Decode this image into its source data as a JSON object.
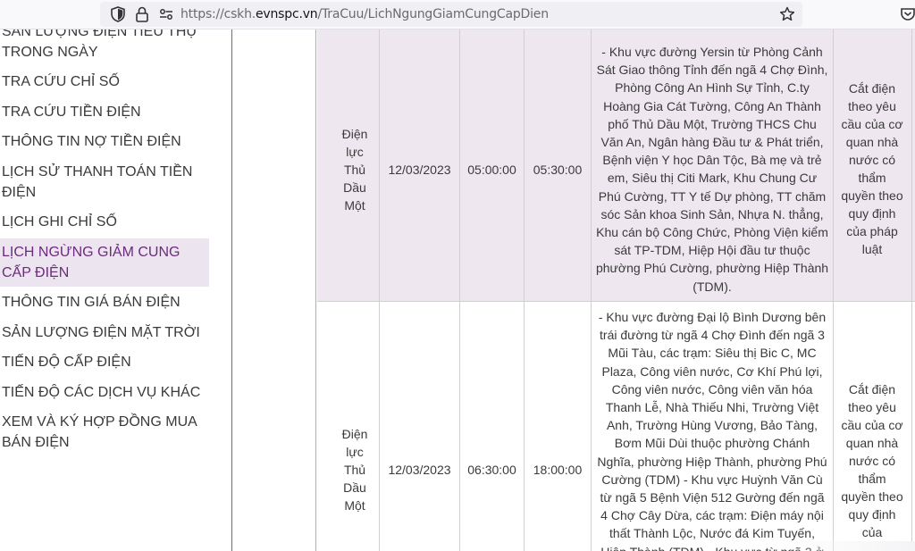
{
  "browser": {
    "url_prefix": "https://cskh.",
    "url_host": "evnspc.vn",
    "url_path": "/TraCuu/LichNgungGiamCungCapDien"
  },
  "sidebar": {
    "items": [
      {
        "label": "SẢN LƯỢNG ĐIỆN TIÊU THỤ TRONG NGÀY"
      },
      {
        "label": "TRA CỨU CHỈ SỐ"
      },
      {
        "label": "TRA CỨU TIỀN ĐIỆN"
      },
      {
        "label": "THÔNG TIN NỢ TIỀN ĐIỆN"
      },
      {
        "label": "LỊCH SỬ THANH TOÁN TIỀN ĐIỆN"
      },
      {
        "label": "LỊCH GHI CHỈ SỐ"
      },
      {
        "label": "LỊCH NGỪNG GIẢM CUNG CẤP ĐIỆN"
      },
      {
        "label": "THÔNG TIN GIÁ BÁN ĐIỆN"
      },
      {
        "label": "SẢN LƯỢNG ĐIỆN MẶT TRỜI"
      },
      {
        "label": "TIẾN ĐỘ CẤP ĐIỆN"
      },
      {
        "label": "TIẾN ĐỘ CÁC DỊCH VỤ KHÁC"
      },
      {
        "label": "XEM VÀ KÝ HỢP ĐỒNG MUA BÁN ĐIỆN"
      }
    ]
  },
  "table": {
    "rows": [
      {
        "unit": "Điện lực Thủ Dầu Một",
        "date": "12/03/2023",
        "start": "05:00:00",
        "end": "05:30:00",
        "area": "- Khu vực đường Yersin từ Phòng Cảnh Sát Giao thông Tỉnh đến ngã 4 Chợ Đình, Phòng Công An Hình Sự Tỉnh, C.ty Hoàng Gia Cát Tường, Công An Thành phố Thủ Dầu Một, Trường THCS Chu Văn An, Ngân hàng Đầu tư & Phát triển, Bệnh viện Y học Dân Tộc, Bà mẹ và trẻ em, Siêu thị Citi Mark, Khu Chung Cư Phú Cường, TT Y tế Dự phòng, TT chăm sóc Sản khoa Sinh Sản, Nhựa N. thẳng, Khu cán bộ Công Chức, Phòng Viện kiểm sát TP-TDM, Hiệp Hội đầu tư thuộc phường Phú Cường, phường Hiệp Thành (TDM).",
        "reason": "Cắt điện theo yêu cầu của cơ quan nhà nước có thẩm quyền theo quy định của pháp luật"
      },
      {
        "unit": "Điện lực Thủ Dầu Một",
        "date": "12/03/2023",
        "start": "06:30:00",
        "end": "18:00:00",
        "area": "- Khu vực đường Đại lộ Bình Dương bên trái đường từ ngã 4 Chợ Đình đến ngã 3 Mũi Tàu, các trạm: Siêu thị Bic C, MC Plaza, Công viên nước, Cơ Khí Phú lợi, Công viên nước, Công viên văn hóa Thanh Lễ, Nhà Thiếu Nhi, Trường Việt Anh, Trường Hùng Vương, Bảo Tàng, Bơm Mũi Dùi thuộc phường Chánh Nghĩa, phường Hiệp Thành, phường Phú Cường (TDM) - Khu vực Huỳnh Văn Cù từ ngã 5 Bệnh Viện 512 Gường đến ngã 4 Chợ Cây Dừa, các trạm: Điện máy nội thất Thành Lộc, Nước đá Kim Tuyến, Hiệp Thành (TDM) - Khu vực từ ngã 3 ở",
        "reason": "Cắt điện theo yêu cầu của cơ quan nhà nước có thẩm quyền theo quy định của"
      }
    ]
  }
}
